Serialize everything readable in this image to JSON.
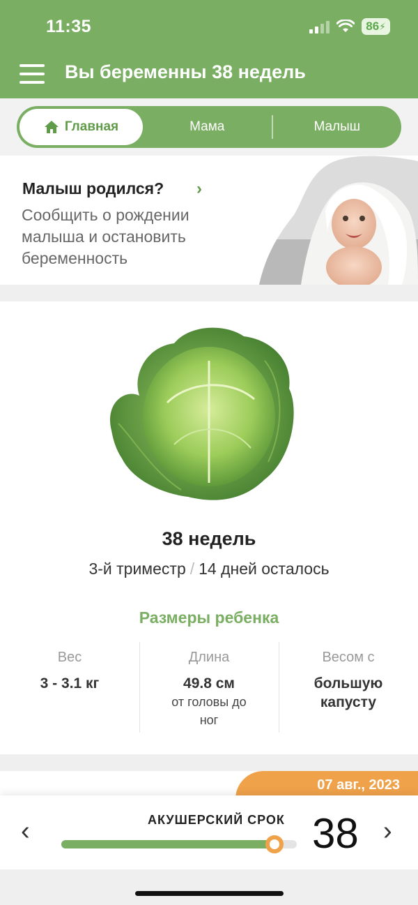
{
  "status_bar": {
    "time": "11:35",
    "battery": "86"
  },
  "header": {
    "title": "Вы беременны 38 недель"
  },
  "tabs": [
    {
      "label": "Главная",
      "icon": "home-icon",
      "active": true
    },
    {
      "label": "Мама"
    },
    {
      "label": "Малыш"
    }
  ],
  "banner": {
    "title": "Малыш родился?",
    "chevron": "›",
    "description": "Сообщить о рождении малыша и остановить беременность",
    "image": "baby-under-towel-photo"
  },
  "week_card": {
    "image": "cabbage-illustration",
    "weeks": "38 недель",
    "trimester": "3-й триместр",
    "separator": "/",
    "days_left": "14 дней осталось",
    "sizes_title": "Размеры ребенка",
    "stats": [
      {
        "label": "Вес",
        "value": "3 - 3.1 кг",
        "sub": ""
      },
      {
        "label": "Длина",
        "value": "49.8 см",
        "sub": "от головы до ног"
      },
      {
        "label": "Весом с",
        "value": "большую капусту",
        "sub": ""
      }
    ]
  },
  "date_badge": "07 авг., 2023",
  "bottom_nav": {
    "label": "АКУШЕРСКИЙ СРОК",
    "week": "38",
    "progress_fraction": 0.905,
    "prev": "‹",
    "next": "›"
  },
  "colors": {
    "brand_green": "#7aae62",
    "accent_orange": "#f0a24a"
  }
}
